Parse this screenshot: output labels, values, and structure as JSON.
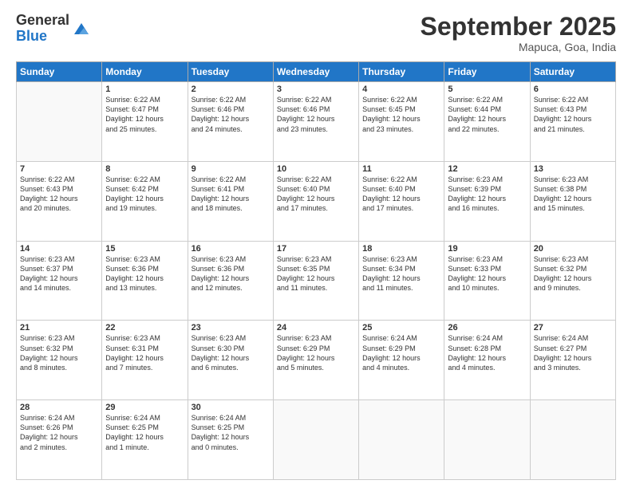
{
  "logo": {
    "general": "General",
    "blue": "Blue"
  },
  "title": "September 2025",
  "location": "Mapuca, Goa, India",
  "days_of_week": [
    "Sunday",
    "Monday",
    "Tuesday",
    "Wednesday",
    "Thursday",
    "Friday",
    "Saturday"
  ],
  "weeks": [
    [
      {
        "day": "",
        "info": ""
      },
      {
        "day": "1",
        "info": "Sunrise: 6:22 AM\nSunset: 6:47 PM\nDaylight: 12 hours\nand 25 minutes."
      },
      {
        "day": "2",
        "info": "Sunrise: 6:22 AM\nSunset: 6:46 PM\nDaylight: 12 hours\nand 24 minutes."
      },
      {
        "day": "3",
        "info": "Sunrise: 6:22 AM\nSunset: 6:46 PM\nDaylight: 12 hours\nand 23 minutes."
      },
      {
        "day": "4",
        "info": "Sunrise: 6:22 AM\nSunset: 6:45 PM\nDaylight: 12 hours\nand 23 minutes."
      },
      {
        "day": "5",
        "info": "Sunrise: 6:22 AM\nSunset: 6:44 PM\nDaylight: 12 hours\nand 22 minutes."
      },
      {
        "day": "6",
        "info": "Sunrise: 6:22 AM\nSunset: 6:43 PM\nDaylight: 12 hours\nand 21 minutes."
      }
    ],
    [
      {
        "day": "7",
        "info": "Sunrise: 6:22 AM\nSunset: 6:43 PM\nDaylight: 12 hours\nand 20 minutes."
      },
      {
        "day": "8",
        "info": "Sunrise: 6:22 AM\nSunset: 6:42 PM\nDaylight: 12 hours\nand 19 minutes."
      },
      {
        "day": "9",
        "info": "Sunrise: 6:22 AM\nSunset: 6:41 PM\nDaylight: 12 hours\nand 18 minutes."
      },
      {
        "day": "10",
        "info": "Sunrise: 6:22 AM\nSunset: 6:40 PM\nDaylight: 12 hours\nand 17 minutes."
      },
      {
        "day": "11",
        "info": "Sunrise: 6:22 AM\nSunset: 6:40 PM\nDaylight: 12 hours\nand 17 minutes."
      },
      {
        "day": "12",
        "info": "Sunrise: 6:23 AM\nSunset: 6:39 PM\nDaylight: 12 hours\nand 16 minutes."
      },
      {
        "day": "13",
        "info": "Sunrise: 6:23 AM\nSunset: 6:38 PM\nDaylight: 12 hours\nand 15 minutes."
      }
    ],
    [
      {
        "day": "14",
        "info": "Sunrise: 6:23 AM\nSunset: 6:37 PM\nDaylight: 12 hours\nand 14 minutes."
      },
      {
        "day": "15",
        "info": "Sunrise: 6:23 AM\nSunset: 6:36 PM\nDaylight: 12 hours\nand 13 minutes."
      },
      {
        "day": "16",
        "info": "Sunrise: 6:23 AM\nSunset: 6:36 PM\nDaylight: 12 hours\nand 12 minutes."
      },
      {
        "day": "17",
        "info": "Sunrise: 6:23 AM\nSunset: 6:35 PM\nDaylight: 12 hours\nand 11 minutes."
      },
      {
        "day": "18",
        "info": "Sunrise: 6:23 AM\nSunset: 6:34 PM\nDaylight: 12 hours\nand 11 minutes."
      },
      {
        "day": "19",
        "info": "Sunrise: 6:23 AM\nSunset: 6:33 PM\nDaylight: 12 hours\nand 10 minutes."
      },
      {
        "day": "20",
        "info": "Sunrise: 6:23 AM\nSunset: 6:32 PM\nDaylight: 12 hours\nand 9 minutes."
      }
    ],
    [
      {
        "day": "21",
        "info": "Sunrise: 6:23 AM\nSunset: 6:32 PM\nDaylight: 12 hours\nand 8 minutes."
      },
      {
        "day": "22",
        "info": "Sunrise: 6:23 AM\nSunset: 6:31 PM\nDaylight: 12 hours\nand 7 minutes."
      },
      {
        "day": "23",
        "info": "Sunrise: 6:23 AM\nSunset: 6:30 PM\nDaylight: 12 hours\nand 6 minutes."
      },
      {
        "day": "24",
        "info": "Sunrise: 6:23 AM\nSunset: 6:29 PM\nDaylight: 12 hours\nand 5 minutes."
      },
      {
        "day": "25",
        "info": "Sunrise: 6:24 AM\nSunset: 6:29 PM\nDaylight: 12 hours\nand 4 minutes."
      },
      {
        "day": "26",
        "info": "Sunrise: 6:24 AM\nSunset: 6:28 PM\nDaylight: 12 hours\nand 4 minutes."
      },
      {
        "day": "27",
        "info": "Sunrise: 6:24 AM\nSunset: 6:27 PM\nDaylight: 12 hours\nand 3 minutes."
      }
    ],
    [
      {
        "day": "28",
        "info": "Sunrise: 6:24 AM\nSunset: 6:26 PM\nDaylight: 12 hours\nand 2 minutes."
      },
      {
        "day": "29",
        "info": "Sunrise: 6:24 AM\nSunset: 6:25 PM\nDaylight: 12 hours\nand 1 minute."
      },
      {
        "day": "30",
        "info": "Sunrise: 6:24 AM\nSunset: 6:25 PM\nDaylight: 12 hours\nand 0 minutes."
      },
      {
        "day": "",
        "info": ""
      },
      {
        "day": "",
        "info": ""
      },
      {
        "day": "",
        "info": ""
      },
      {
        "day": "",
        "info": ""
      }
    ]
  ]
}
